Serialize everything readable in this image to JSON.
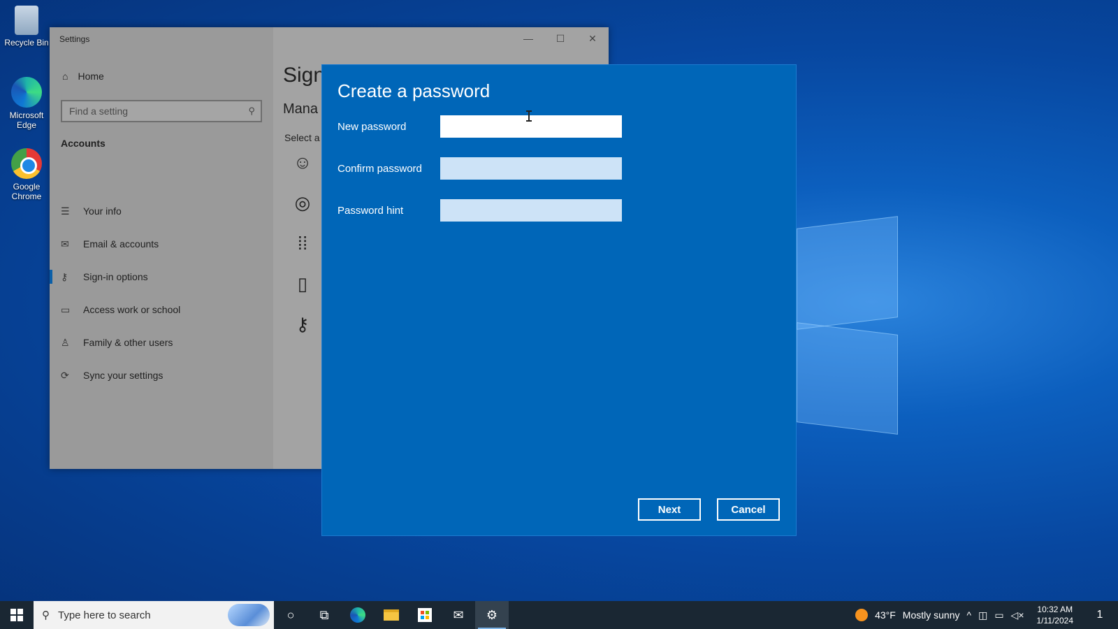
{
  "desktop": {
    "icons": [
      {
        "label": "Recycle Bin"
      },
      {
        "label": "Microsoft Edge"
      },
      {
        "label": "Google Chrome"
      }
    ]
  },
  "settings_window": {
    "title": "Settings",
    "home_label": "Home",
    "search_placeholder": "Find a setting",
    "section_label": "Accounts",
    "nav_items": [
      {
        "label": "Your info",
        "icon": "person-card-icon"
      },
      {
        "label": "Email & accounts",
        "icon": "mail-icon"
      },
      {
        "label": "Sign-in options",
        "icon": "key-icon",
        "active": true
      },
      {
        "label": "Access work or school",
        "icon": "briefcase-icon"
      },
      {
        "label": "Family & other users",
        "icon": "person-icon"
      },
      {
        "label": "Sync your settings",
        "icon": "sync-icon"
      }
    ],
    "content_heading": "Sign",
    "content_subheading": "Mana",
    "content_select": "Select a"
  },
  "dialog": {
    "title": "Create a password",
    "fields": [
      {
        "label": "New password",
        "value": "",
        "focused": true
      },
      {
        "label": "Confirm password",
        "value": "",
        "focused": false
      },
      {
        "label": "Password hint",
        "value": "",
        "focused": false
      }
    ],
    "next_label": "Next",
    "cancel_label": "Cancel"
  },
  "taskbar": {
    "search_placeholder": "Type here to search",
    "weather_temp": "43°F",
    "weather_desc": "Mostly sunny",
    "time": "10:32 AM",
    "date": "1/11/2024",
    "notification_count": "1"
  },
  "colors": {
    "dialog_bg": "#0066b8",
    "taskbar_bg": "#1a2733",
    "accent": "#0b5fa8"
  }
}
